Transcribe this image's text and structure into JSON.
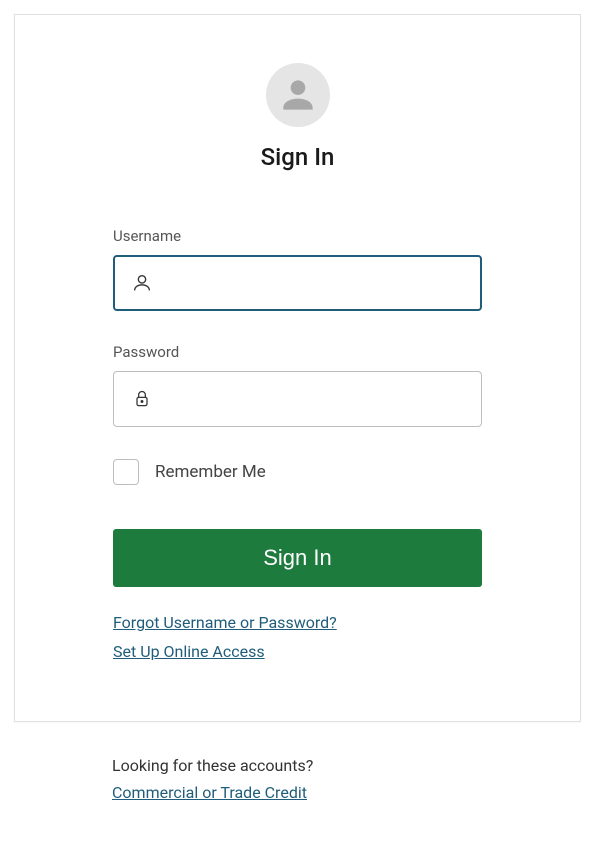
{
  "title": "Sign In",
  "fields": {
    "username": {
      "label": "Username",
      "value": ""
    },
    "password": {
      "label": "Password",
      "value": ""
    }
  },
  "remember": {
    "label": "Remember Me",
    "checked": false
  },
  "buttons": {
    "signin": "Sign In"
  },
  "links": {
    "forgot": "Forgot Username or Password?",
    "setup": "Set Up Online Access",
    "commercial": "Commercial or Trade Credit"
  },
  "below": {
    "prompt": "Looking for these accounts?"
  },
  "colors": {
    "accent": "#1e7b3e",
    "focus_border": "#1f5d7a",
    "link": "#1f5d7a"
  }
}
